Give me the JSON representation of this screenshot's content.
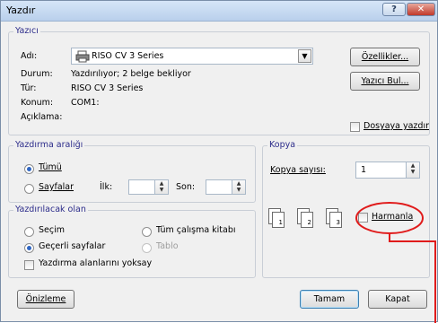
{
  "window": {
    "title": "Yazdır",
    "help_glyph": "?",
    "close_glyph": "✕"
  },
  "printer": {
    "group_label": "Yazıcı",
    "name_label": "Adı:",
    "name_value": "RISO CV 3 Series",
    "status_label": "Durum:",
    "status_value": "Yazdırılıyor; 2 belge bekliyor",
    "type_label": "Tür:",
    "type_value": "RISO CV 3 Series",
    "location_label": "Konum:",
    "location_value": "COM1:",
    "comment_label": "Açıklama:",
    "properties_button": "Özellikler...",
    "find_printer_button": "Yazıcı Bul...",
    "print_to_file_label": "Dosyaya yazdır"
  },
  "range": {
    "group_label": "Yazdırma aralığı",
    "all_label": "Tümü",
    "pages_label": "Sayfalar",
    "from_label": "İlk:",
    "to_label": "Son:",
    "from_value": "",
    "to_value": ""
  },
  "what": {
    "group_label": "Yazdırılacak olan",
    "selection_label": "Seçim",
    "current_page_label": "Geçerli sayfalar",
    "entire_workbook_label": "Tüm çalışma kitabı",
    "table_label": "Tablo",
    "ignore_print_areas_label": "Yazdırma alanlarını yoksay"
  },
  "copies": {
    "group_label": "Kopya",
    "count_label": "Kopya sayısı:",
    "count_value": "1",
    "collate_label": "Harmanla",
    "page_numbers": [
      "1",
      "2",
      "3"
    ]
  },
  "footer": {
    "preview_button": "Önizleme",
    "ok_button": "Tamam",
    "cancel_button": "Kapat"
  },
  "colors": {
    "annotation_red": "#e01b1b"
  }
}
